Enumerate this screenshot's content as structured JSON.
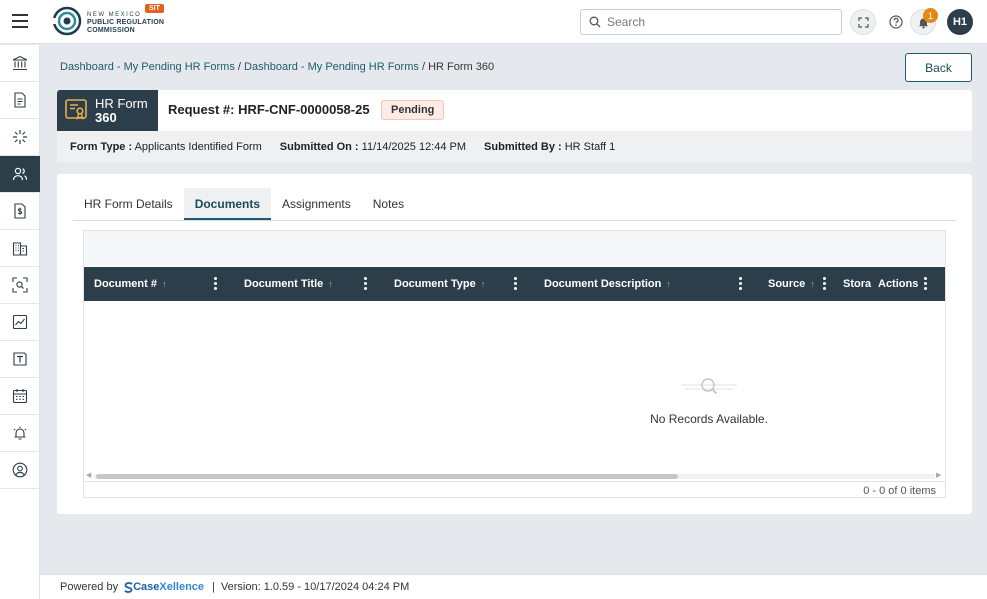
{
  "header": {
    "org_line1": "NEW MEXICO",
    "org_line2": "PUBLIC REGULATION",
    "org_line3": "COMMISSION",
    "env_badge": "SIT",
    "search_placeholder": "Search",
    "notification_count": "1",
    "user_initials": "H1"
  },
  "sidebar": {
    "items": [
      {
        "icon": "bank-icon"
      },
      {
        "icon": "document-icon"
      },
      {
        "icon": "spark-icon"
      },
      {
        "icon": "users-icon",
        "active": true
      },
      {
        "icon": "dollar-doc-icon"
      },
      {
        "icon": "building-icon"
      },
      {
        "icon": "scan-search-icon"
      },
      {
        "icon": "chart-icon"
      },
      {
        "icon": "template-icon"
      },
      {
        "icon": "calendar-icon"
      },
      {
        "icon": "alarm-icon"
      },
      {
        "icon": "user-circle-icon"
      }
    ]
  },
  "breadcrumb": {
    "item1": "Dashboard - My Pending HR Forms",
    "item2": "Dashboard - My Pending HR Forms",
    "current": "HR Form 360"
  },
  "back_label": "Back",
  "request": {
    "tag_line1": "HR Form",
    "tag_line2": "360",
    "number": "Request #: HRF-CNF-0000058-25",
    "status": "Pending",
    "form_type_label": "Form Type :",
    "form_type_value": "Applicants Identified Form",
    "submitted_on_label": "Submitted On :",
    "submitted_on_value": "11/14/2025 12:44 PM",
    "submitted_by_label": "Submitted By :",
    "submitted_by_value": "HR Staff 1"
  },
  "tabs": [
    {
      "label": "HR Form Details"
    },
    {
      "label": "Documents",
      "active": true
    },
    {
      "label": "Assignments"
    },
    {
      "label": "Notes"
    }
  ],
  "grid": {
    "columns": [
      "Document #",
      "Document Title",
      "Document Type",
      "Document Description",
      "Source",
      "Stora",
      "Actions"
    ],
    "empty_message": "No Records Available.",
    "pager": "0 - 0 of 0 items"
  },
  "footer": {
    "powered_by": "Powered by",
    "brand_a": "Case",
    "brand_b": "Xellence",
    "separator": "|",
    "version": "Version: 1.0.59 - 10/17/2024 04:24 PM"
  },
  "colors": {
    "primary_dark": "#2b3e4a",
    "link": "#1d5c6c",
    "badge_orange": "#e28a16",
    "env_orange": "#e0621f"
  }
}
